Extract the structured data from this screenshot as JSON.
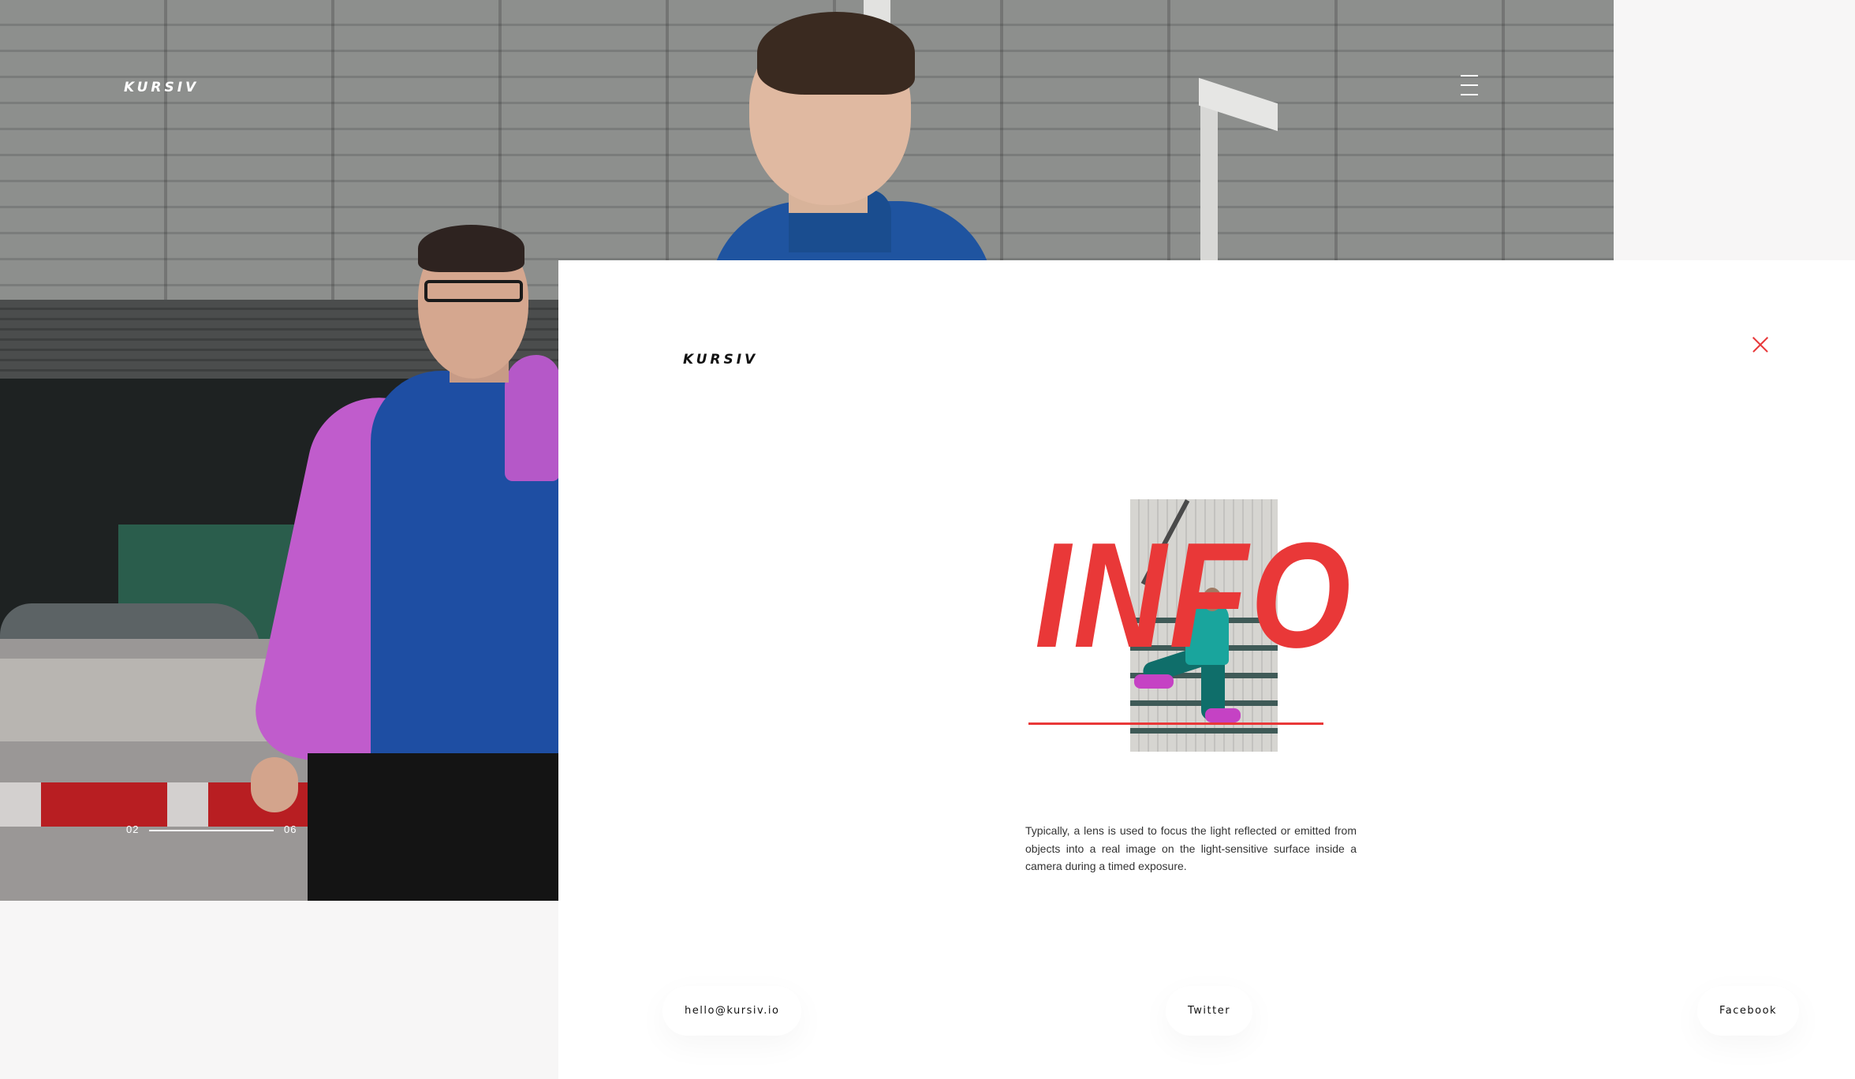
{
  "brand": {
    "logo": "KURSIV"
  },
  "hero": {
    "slide_current": "02",
    "slide_total": "06",
    "menu_icon": "hamburger-menu-icon"
  },
  "info_panel": {
    "title": "INFO",
    "description": "Typically, a lens is used to focus the light reflected or emitted from objects into a real image on the light-sensitive surface inside a camera during a timed exposure.",
    "close_icon": "close-icon",
    "accent_color": "#e93838"
  },
  "footer": {
    "email": "hello@kursiv.io",
    "twitter": "Twitter",
    "facebook": "Facebook"
  }
}
